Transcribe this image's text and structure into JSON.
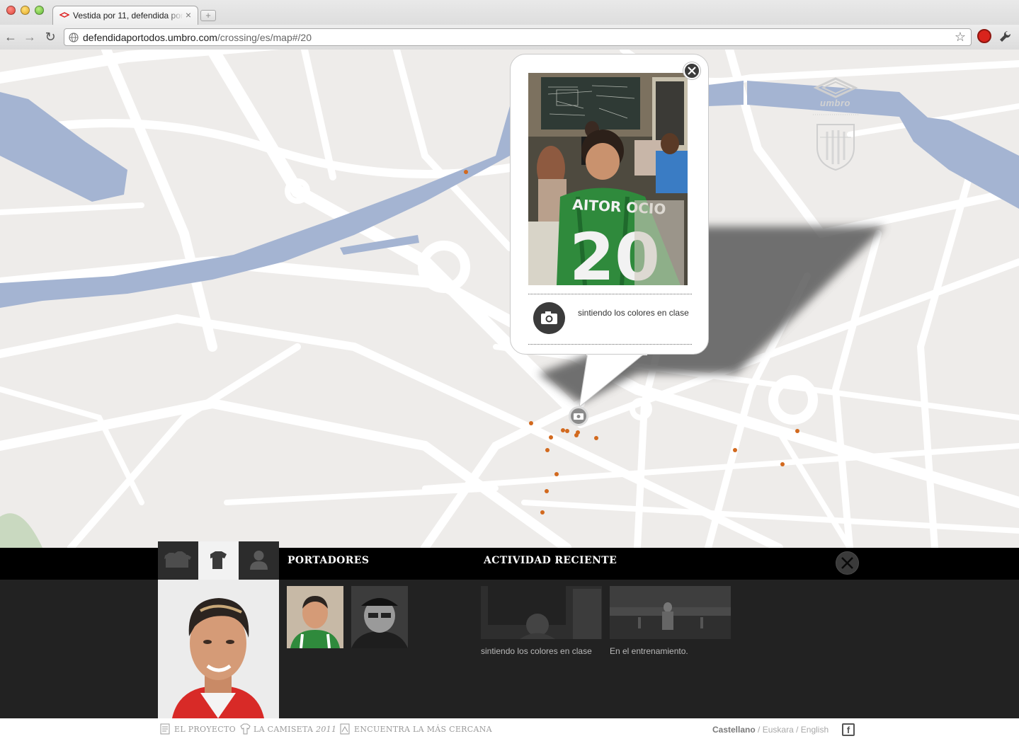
{
  "browser": {
    "tab_title": "Vestida por 11, defendida por todos",
    "tab_close": "×",
    "new_tab": "+",
    "url_host": "defendidaportodos.umbro.com",
    "url_path": "/crossing/es/map#/20",
    "back": "←",
    "forward": "→",
    "reload": "↻",
    "bookmark": "☆"
  },
  "map": {
    "brand": "umbro",
    "club_badge": "athletic-club-badge",
    "colors": {
      "land": "#eeecea",
      "road": "#ffffff",
      "river": "#a4b4d2",
      "marker": "#d2691e"
    }
  },
  "popup": {
    "caption": "sintiendo los colores en clase",
    "jersey_name": "AITOR OCIO",
    "jersey_number": "20"
  },
  "panel": {
    "carriers_title": "PORTADORES",
    "activity_title": "ACTIVIDAD RECIENTE",
    "tabs": [
      {
        "icon": "group-shirts-icon"
      },
      {
        "icon": "shirt-icon"
      },
      {
        "icon": "person-icon"
      }
    ],
    "activity": [
      {
        "caption": "sintiendo los colores en clase"
      },
      {
        "caption": "En el entrenamiento."
      }
    ]
  },
  "footer": {
    "nav": [
      {
        "label": "EL PROYECTO",
        "icon": "document-icon"
      },
      {
        "label": "LA CAMISETA",
        "label_em": "2011",
        "icon": "shirt-outline-icon"
      },
      {
        "label": "ENCUENTRA LA MÁS CERCANA",
        "icon": "map-pin-icon"
      }
    ],
    "languages": {
      "active": "Castellano",
      "others": [
        "Euskara",
        "English"
      ],
      "sep": "/"
    },
    "facebook": "f"
  }
}
